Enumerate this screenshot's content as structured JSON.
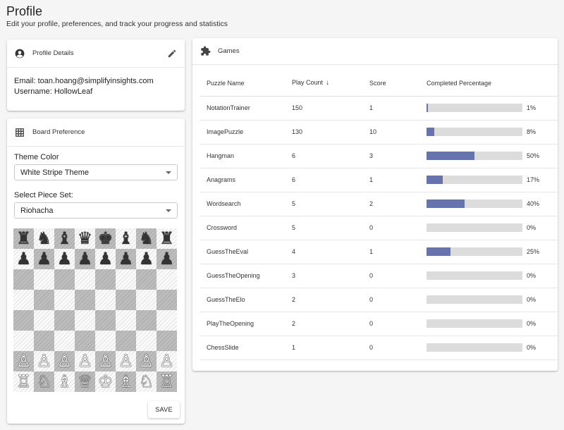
{
  "page": {
    "title": "Profile",
    "subtitle": "Edit your profile, preferences, and track your progress and statistics"
  },
  "profile_details": {
    "heading": "Profile Details",
    "email_line": "Email: toan.hoang@simplifyinsights.com",
    "username_line": "Username: HollowLeaf"
  },
  "board_preference": {
    "heading": "Board Preference",
    "theme_label": "Theme Color",
    "theme_value": "White Stripe Theme",
    "piece_label": "Select Piece Set:",
    "piece_value": "Riohacha",
    "save_label": "SAVE",
    "board_rows": [
      [
        "♜",
        "♞",
        "♝",
        "♛",
        "♚",
        "♝",
        "♞",
        "♜"
      ],
      [
        "♟",
        "♟",
        "♟",
        "♟",
        "♟",
        "♟",
        "♟",
        "♟"
      ],
      [
        "",
        "",
        "",
        "",
        "",
        "",
        "",
        ""
      ],
      [
        "",
        "",
        "",
        "",
        "",
        "",
        "",
        ""
      ],
      [
        "",
        "",
        "",
        "",
        "",
        "",
        "",
        ""
      ],
      [
        "",
        "",
        "",
        "",
        "",
        "",
        "",
        ""
      ],
      [
        "♙",
        "♙",
        "♙",
        "♙",
        "♙",
        "♙",
        "♙",
        "♙"
      ],
      [
        "♖",
        "♘",
        "♗",
        "♕",
        "♔",
        "♗",
        "♘",
        "♖"
      ]
    ]
  },
  "games": {
    "heading": "Games",
    "columns": {
      "name": "Puzzle Name",
      "count": "Play Count",
      "score": "Score",
      "pct": "Completed Percentage"
    },
    "rows": [
      {
        "name": "NotationTrainer",
        "count": "150",
        "score": "1",
        "pct": "1%",
        "fill": 1
      },
      {
        "name": "ImagePuzzle",
        "count": "130",
        "score": "10",
        "pct": "8%",
        "fill": 8
      },
      {
        "name": "Hangman",
        "count": "6",
        "score": "3",
        "pct": "50%",
        "fill": 50
      },
      {
        "name": "Anagrams",
        "count": "6",
        "score": "1",
        "pct": "17%",
        "fill": 17
      },
      {
        "name": "Wordsearch",
        "count": "5",
        "score": "2",
        "pct": "40%",
        "fill": 40
      },
      {
        "name": "Crossword",
        "count": "5",
        "score": "0",
        "pct": "0%",
        "fill": 0
      },
      {
        "name": "GuessTheEval",
        "count": "4",
        "score": "1",
        "pct": "25%",
        "fill": 25
      },
      {
        "name": "GuessTheOpening",
        "count": "3",
        "score": "0",
        "pct": "0%",
        "fill": 0
      },
      {
        "name": "GuessTheElo",
        "count": "2",
        "score": "0",
        "pct": "0%",
        "fill": 0
      },
      {
        "name": "PlayTheOpening",
        "count": "2",
        "score": "0",
        "pct": "0%",
        "fill": 0
      },
      {
        "name": "ChessSlide",
        "count": "1",
        "score": "0",
        "pct": "0%",
        "fill": 0
      }
    ]
  },
  "icons": {
    "profile": "account-circle-icon",
    "edit": "pencil-icon",
    "board": "grid-icon",
    "games": "puzzle-icon",
    "sort": "arrow-down-icon"
  },
  "colors": {
    "bar_fill": "#6673ae",
    "bar_track": "#dcdcdc"
  }
}
